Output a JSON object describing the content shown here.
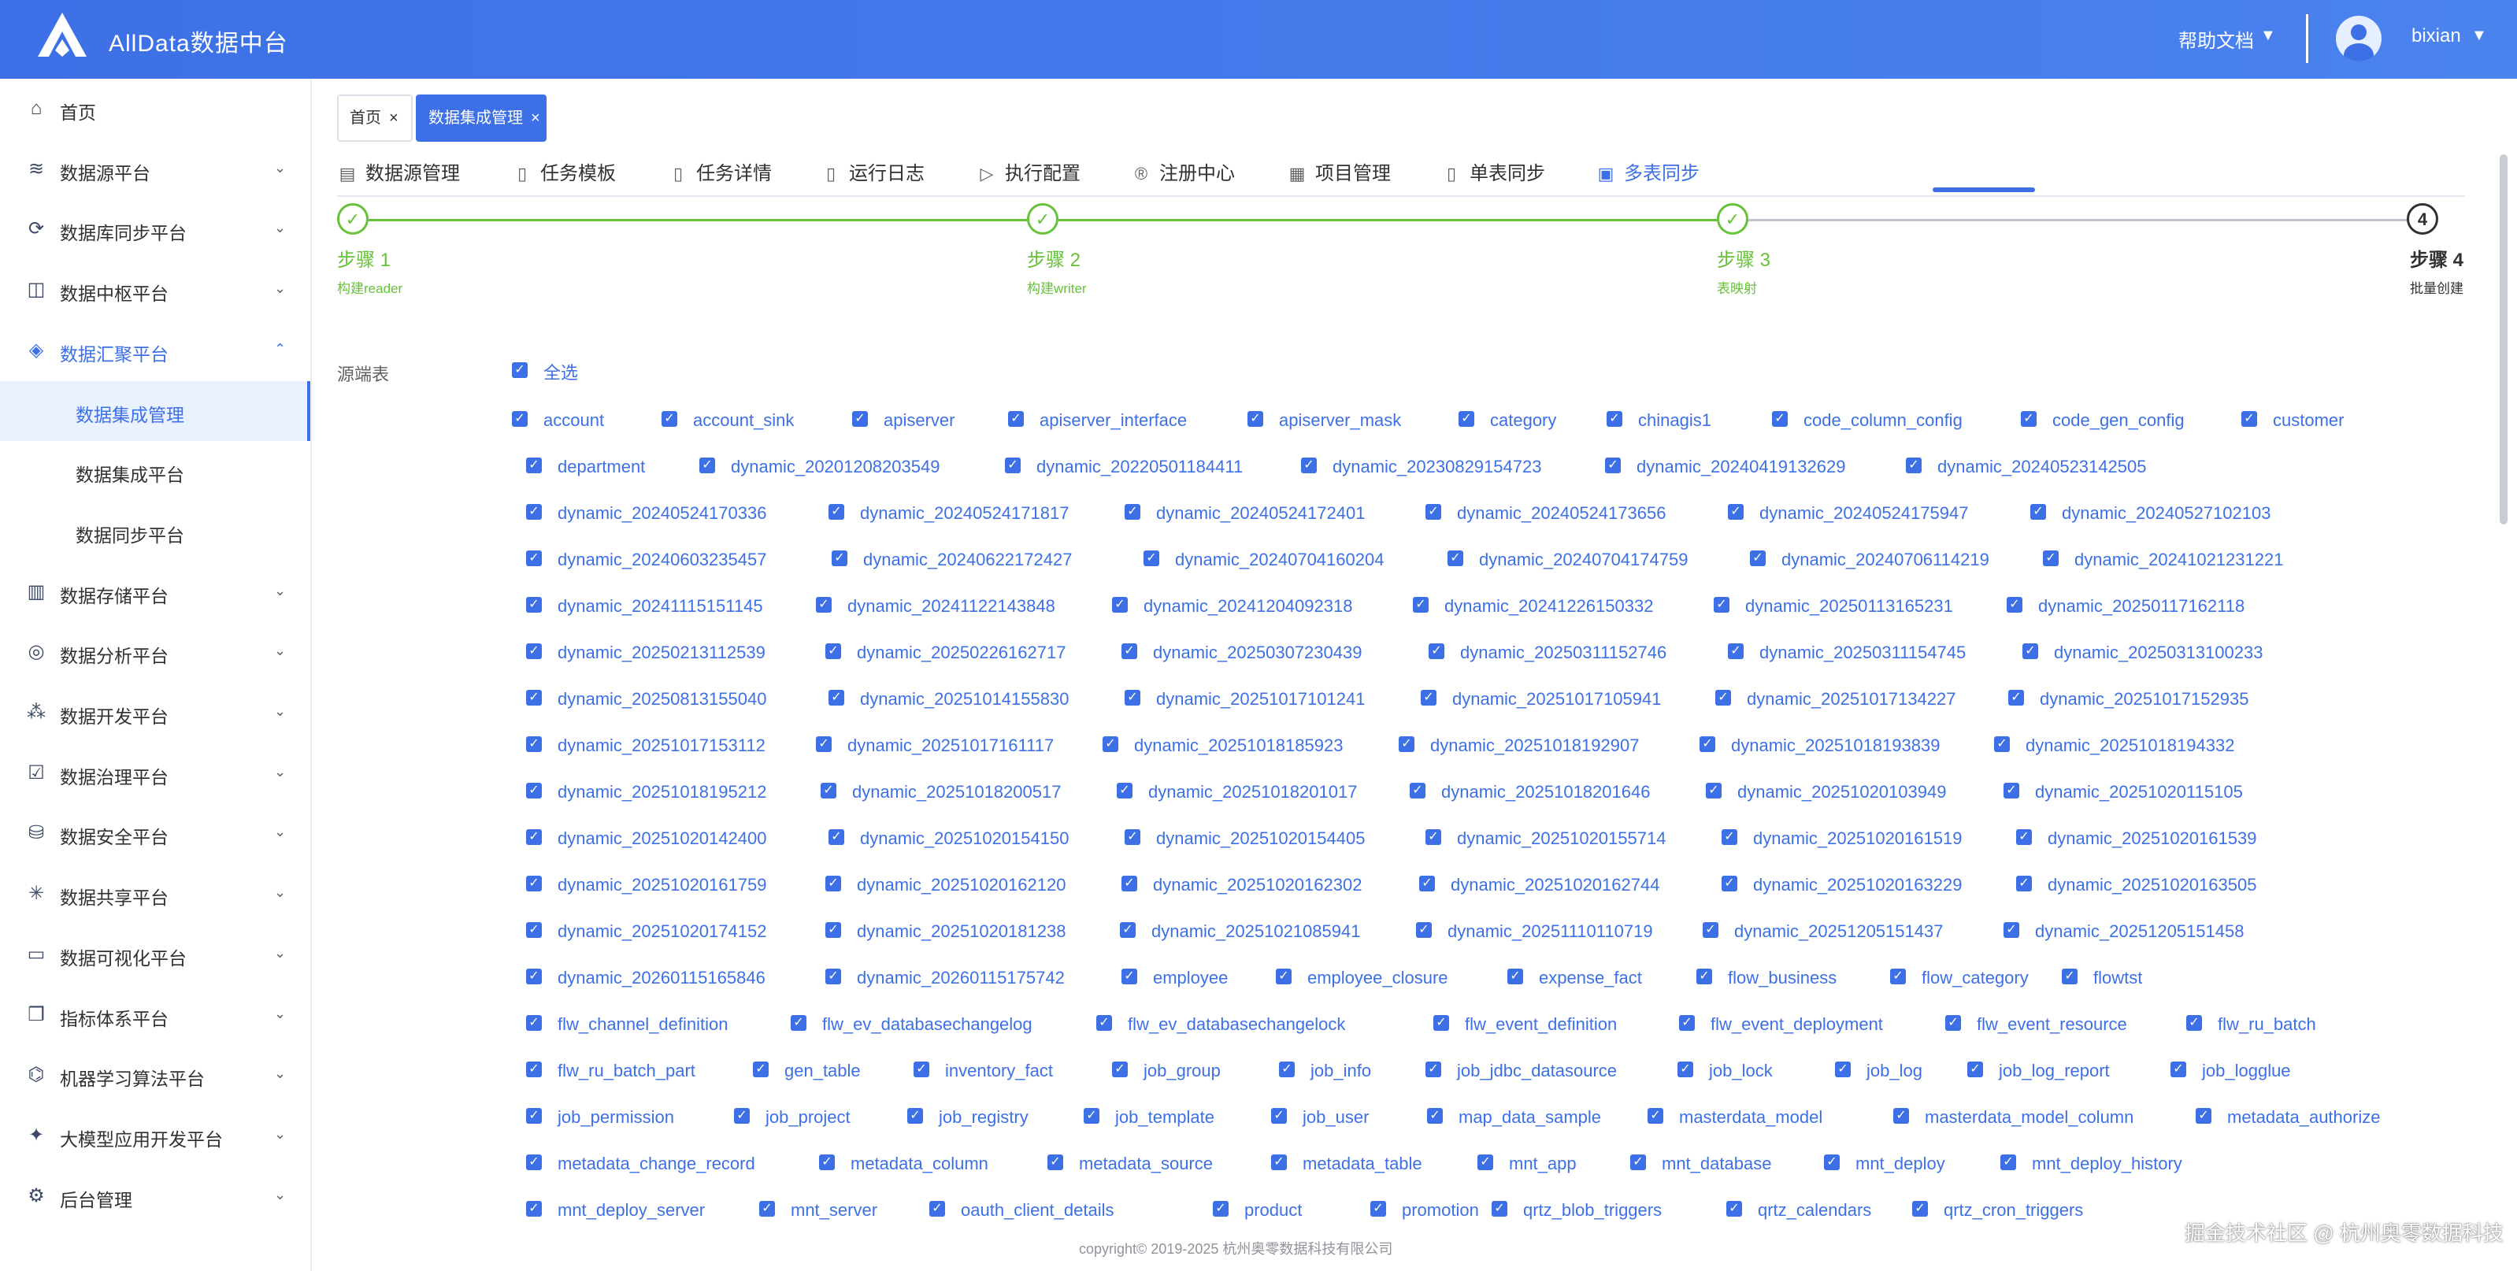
{
  "header": {
    "title": "AllData数据中台",
    "help": "帮助文档",
    "help_caret": "▼",
    "user": "bixian",
    "user_caret": "▼"
  },
  "sidebar": {
    "items": [
      {
        "label": "首页",
        "icon": "home-icon"
      },
      {
        "label": "数据源平台",
        "icon": "database-icon"
      },
      {
        "label": "数据库同步平台",
        "icon": "sync-icon"
      },
      {
        "label": "数据中枢平台",
        "icon": "hub-icon"
      },
      {
        "label": "数据汇聚平台",
        "icon": "layers-icon"
      },
      {
        "label": "数据集成管理",
        "icon": ""
      },
      {
        "label": "数据集成平台",
        "icon": ""
      },
      {
        "label": "数据同步平台",
        "icon": ""
      },
      {
        "label": "数据存储平台",
        "icon": "storage-icon"
      },
      {
        "label": "数据分析平台",
        "icon": "analysis-icon"
      },
      {
        "label": "数据开发平台",
        "icon": "develop-icon"
      },
      {
        "label": "数据治理平台",
        "icon": "governance-icon"
      },
      {
        "label": "数据安全平台",
        "icon": "security-icon"
      },
      {
        "label": "数据共享平台",
        "icon": "share-icon"
      },
      {
        "label": "数据可视化平台",
        "icon": "monitor-icon"
      },
      {
        "label": "指标体系平台",
        "icon": "cube-icon"
      },
      {
        "label": "机器学习算法平台",
        "icon": "ml-icon"
      },
      {
        "label": "大模型应用开发平台",
        "icon": "llm-icon"
      },
      {
        "label": "后台管理",
        "icon": "admin-icon"
      }
    ],
    "chevron_down": "⌄",
    "chevron_up": "⌃"
  },
  "tags": [
    {
      "label": "首页",
      "close": "×"
    },
    {
      "label": "数据集成管理",
      "close": "×"
    }
  ],
  "tabs": [
    {
      "label": "数据源管理",
      "icon": "chart-icon"
    },
    {
      "label": "任务模板",
      "icon": "document-icon"
    },
    {
      "label": "任务详情",
      "icon": "document-icon"
    },
    {
      "label": "运行日志",
      "icon": "document-icon"
    },
    {
      "label": "执行配置",
      "icon": "play-icon"
    },
    {
      "label": "注册中心",
      "icon": "registered-icon"
    },
    {
      "label": "项目管理",
      "icon": "grid-icon"
    },
    {
      "label": "单表同步",
      "icon": "document-icon"
    },
    {
      "label": "多表同步",
      "icon": "calendar-icon"
    }
  ],
  "steps": [
    {
      "title": "步骤 1",
      "desc": "构建reader",
      "node": "✓",
      "status": "done"
    },
    {
      "title": "步骤 2",
      "desc": "构建writer",
      "node": "✓",
      "status": "done"
    },
    {
      "title": "步骤 3",
      "desc": "表映射",
      "node": "✓",
      "status": "done"
    },
    {
      "title": "步骤 4",
      "desc": "批量创建",
      "node": "4",
      "status": "current"
    }
  ],
  "form": {
    "source_label": "源端表",
    "select_all": "全选",
    "check_mark": "✓"
  },
  "tables": [
    [
      "account",
      "account_sink",
      "apiserver",
      "apiserver_interface",
      "apiserver_mask",
      "category",
      "chinagis1",
      "code_column_config",
      "code_gen_config",
      "customer"
    ],
    [
      "department",
      "dynamic_20201208203549",
      "dynamic_20220501184411",
      "dynamic_20230829154723",
      "dynamic_20240419132629",
      "dynamic_20240523142505"
    ],
    [
      "dynamic_20240524170336",
      "dynamic_20240524171817",
      "dynamic_20240524172401",
      "dynamic_20240524173656",
      "dynamic_20240524175947",
      "dynamic_20240527102103"
    ],
    [
      "dynamic_20240603235457",
      "dynamic_20240622172427",
      "dynamic_20240704160204",
      "dynamic_20240704174759",
      "dynamic_20240706114219",
      "dynamic_20241021231221"
    ],
    [
      "dynamic_20241115151145",
      "dynamic_20241122143848",
      "dynamic_20241204092318",
      "dynamic_20241226150332",
      "dynamic_20250113165231",
      "dynamic_20250117162118"
    ],
    [
      "dynamic_20250213112539",
      "dynamic_20250226162717",
      "dynamic_20250307230439",
      "dynamic_20250311152746",
      "dynamic_20250311154745",
      "dynamic_20250313100233"
    ],
    [
      "dynamic_20250813155040",
      "dynamic_20251014155830",
      "dynamic_20251017101241",
      "dynamic_20251017105941",
      "dynamic_20251017134227",
      "dynamic_20251017152935"
    ],
    [
      "dynamic_20251017153112",
      "dynamic_20251017161117",
      "dynamic_20251018185923",
      "dynamic_20251018192907",
      "dynamic_20251018193839",
      "dynamic_20251018194332"
    ],
    [
      "dynamic_20251018195212",
      "dynamic_20251018200517",
      "dynamic_20251018201017",
      "dynamic_20251018201646",
      "dynamic_20251020103949",
      "dynamic_20251020115105"
    ],
    [
      "dynamic_20251020142400",
      "dynamic_20251020154150",
      "dynamic_20251020154405",
      "dynamic_20251020155714",
      "dynamic_20251020161519",
      "dynamic_20251020161539"
    ],
    [
      "dynamic_20251020161759",
      "dynamic_20251020162120",
      "dynamic_20251020162302",
      "dynamic_20251020162744",
      "dynamic_20251020163229",
      "dynamic_20251020163505"
    ],
    [
      "dynamic_20251020174152",
      "dynamic_20251020181238",
      "dynamic_20251021085941",
      "dynamic_20251110110719",
      "dynamic_20251205151437",
      "dynamic_20251205151458"
    ],
    [
      "dynamic_20260115165846",
      "dynamic_20260115175742",
      "employee",
      "employee_closure",
      "expense_fact",
      "flow_business",
      "flow_category",
      "flowtst"
    ],
    [
      "flw_channel_definition",
      "flw_ev_databasechangelog",
      "flw_ev_databasechangelock",
      "flw_event_definition",
      "flw_event_deployment",
      "flw_event_resource",
      "flw_ru_batch"
    ],
    [
      "flw_ru_batch_part",
      "gen_table",
      "inventory_fact",
      "job_group",
      "job_info",
      "job_jdbc_datasource",
      "job_lock",
      "job_log",
      "job_log_report",
      "job_logglue"
    ],
    [
      "job_permission",
      "job_project",
      "job_registry",
      "job_template",
      "job_user",
      "map_data_sample",
      "masterdata_model",
      "masterdata_model_column",
      "metadata_authorize"
    ],
    [
      "metadata_change_record",
      "metadata_column",
      "metadata_source",
      "metadata_table",
      "mnt_app",
      "mnt_database",
      "mnt_deploy",
      "mnt_deploy_history"
    ],
    [
      "mnt_deploy_server",
      "mnt_server",
      "oauth_client_details",
      "product",
      "promotion",
      "qrtz_blob_triggers",
      "qrtz_calendars",
      "qrtz_cron_triggers"
    ]
  ],
  "footer": {
    "copyright": "copyright© 2019-2025 杭州奥零数据科技有限公司",
    "watermark": "掘金技术社区 @ 杭州奥零数据科技"
  }
}
